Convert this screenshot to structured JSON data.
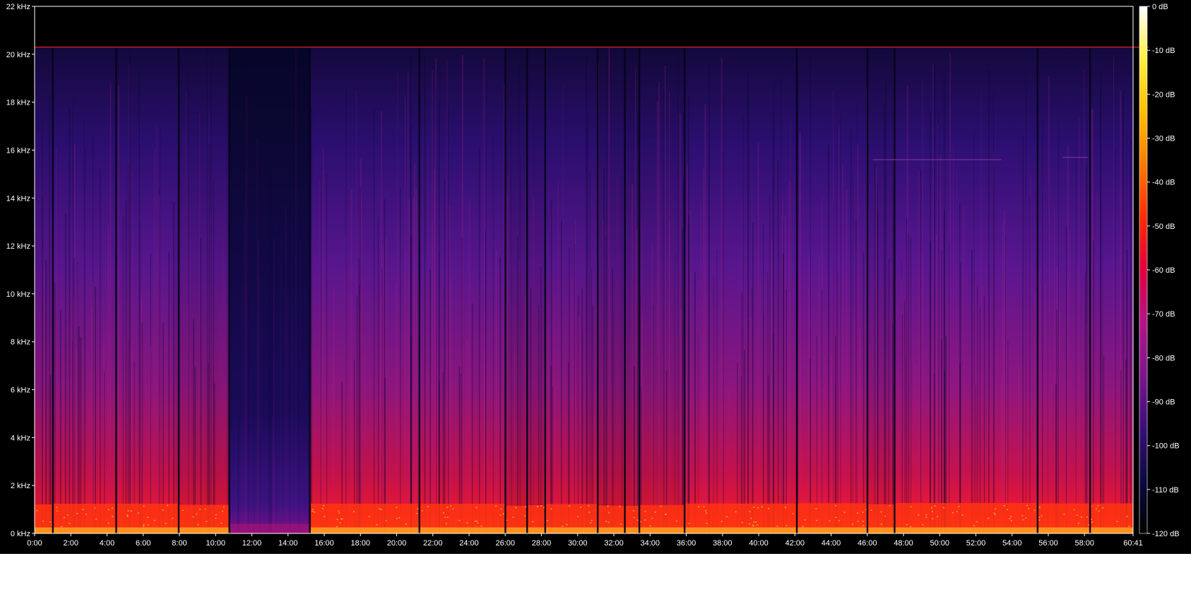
{
  "chart_data": {
    "type": "heatmap",
    "x_axis": {
      "unit": "time",
      "range": [
        "0:00",
        "60:41"
      ],
      "ticks": [
        "0:00",
        "2:00",
        "4:00",
        "6:00",
        "8:00",
        "10:00",
        "12:00",
        "14:00",
        "16:00",
        "18:00",
        "20:00",
        "22:00",
        "24:00",
        "26:00",
        "28:00",
        "30:00",
        "32:00",
        "34:00",
        "36:00",
        "38:00",
        "40:00",
        "42:00",
        "44:00",
        "46:00",
        "48:00",
        "50:00",
        "52:00",
        "54:00",
        "56:00",
        "58:00",
        "60:41"
      ]
    },
    "y_axis": {
      "unit": "kHz",
      "range": [
        0,
        22
      ],
      "ticks": [
        "0 kHz",
        "2 kHz",
        "4 kHz",
        "6 kHz",
        "8 kHz",
        "10 kHz",
        "12 kHz",
        "14 kHz",
        "16 kHz",
        "18 kHz",
        "20 kHz",
        "22 kHz"
      ]
    },
    "colorbar": {
      "unit": "dB",
      "range": [
        -120,
        0
      ],
      "ticks": [
        "0 dB",
        "-10 dB",
        "-20 dB",
        "-30 dB",
        "-40 dB",
        "-50 dB",
        "-60 dB",
        "-70 dB",
        "-80 dB",
        "-90 dB",
        "-100 dB",
        "-110 dB",
        "-120 dB"
      ],
      "colors": [
        "#000000",
        "#0a0a40",
        "#3a0e7a",
        "#7d148f",
        "#b5128a",
        "#e2003c",
        "#ff2a00",
        "#ff7a00",
        "#ffbe00",
        "#ffef40",
        "#ffffff"
      ]
    },
    "lowpass_cutoff_khz": 20.3,
    "cutoff_line_color": "#e0221c",
    "gap_minutes": [
      1.0,
      4.5,
      7.95,
      10.75,
      15.2,
      21.25,
      26.0,
      27.2,
      28.2,
      31.1,
      32.6,
      33.4,
      35.9,
      42.1,
      46.0,
      47.5,
      55.4,
      58.3
    ],
    "quiet_section_minutes": [
      10.75,
      15.2
    ],
    "segment_intensity": [
      {
        "start": 0.0,
        "end": 1.0,
        "level": 0.78
      },
      {
        "start": 1.0,
        "end": 4.5,
        "level": 0.85
      },
      {
        "start": 4.5,
        "end": 7.95,
        "level": 0.86
      },
      {
        "start": 7.95,
        "end": 10.75,
        "level": 0.74
      },
      {
        "start": 10.75,
        "end": 15.2,
        "level": 0.3
      },
      {
        "start": 15.2,
        "end": 21.25,
        "level": 0.86
      },
      {
        "start": 21.25,
        "end": 26.0,
        "level": 0.85
      },
      {
        "start": 26.0,
        "end": 27.2,
        "level": 0.66
      },
      {
        "start": 27.2,
        "end": 28.2,
        "level": 0.7
      },
      {
        "start": 28.2,
        "end": 31.1,
        "level": 0.82
      },
      {
        "start": 31.1,
        "end": 32.6,
        "level": 0.66
      },
      {
        "start": 32.6,
        "end": 33.4,
        "level": 0.64
      },
      {
        "start": 33.4,
        "end": 35.9,
        "level": 0.72
      },
      {
        "start": 35.9,
        "end": 42.1,
        "level": 0.87
      },
      {
        "start": 42.1,
        "end": 46.0,
        "level": 0.9
      },
      {
        "start": 46.0,
        "end": 47.5,
        "level": 0.8
      },
      {
        "start": 47.5,
        "end": 55.4,
        "level": 0.92
      },
      {
        "start": 55.4,
        "end": 58.3,
        "level": 0.88
      },
      {
        "start": 58.3,
        "end": 60.68,
        "level": 0.88
      }
    ],
    "title": "",
    "xlabel": "",
    "ylabel": "",
    "grid": false
  }
}
